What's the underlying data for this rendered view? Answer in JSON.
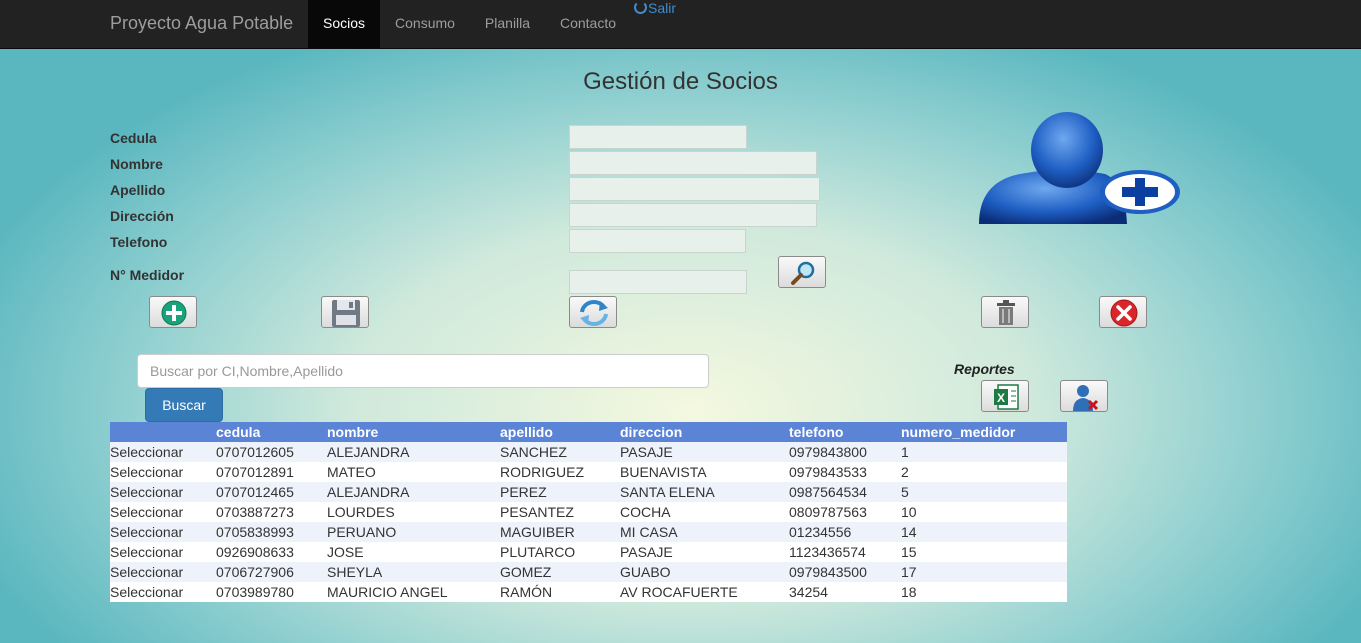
{
  "nav": {
    "brand": "Proyecto Agua Potable",
    "items": [
      {
        "label": "Socios",
        "active": true
      },
      {
        "label": "Consumo",
        "active": false
      },
      {
        "label": "Planilla",
        "active": false
      },
      {
        "label": "Contacto",
        "active": false
      }
    ],
    "logout": "Salir"
  },
  "page": {
    "title": "Gestión de Socios"
  },
  "form": {
    "cedula": {
      "label": "Cedula",
      "value": ""
    },
    "nombre": {
      "label": "Nombre",
      "value": ""
    },
    "apellido": {
      "label": "Apellido",
      "value": ""
    },
    "direccion": {
      "label": "Dirección",
      "value": ""
    },
    "telefono": {
      "label": "Telefono",
      "value": ""
    },
    "medidor": {
      "label": "N° Medidor",
      "value": ""
    }
  },
  "search": {
    "placeholder": "Buscar por CI,Nombre,Apellido",
    "value": "",
    "button": "Buscar"
  },
  "reports": {
    "label": "Reportes"
  },
  "colors": {
    "navbar": "#222222",
    "accent": "#337ab7",
    "table_header": "#5b84d6"
  },
  "icons": [
    "add-icon",
    "save-icon",
    "refresh-icon",
    "magnifier-icon",
    "trash-icon",
    "close-icon",
    "excel-icon",
    "user-remove-icon",
    "user-add-icon"
  ],
  "table": {
    "headers": [
      "",
      "cedula",
      "nombre",
      "apellido",
      "direccion",
      "telefono",
      "numero_medidor"
    ],
    "rows": [
      [
        "Seleccionar",
        "0707012605",
        "ALEJANDRA",
        "SANCHEZ",
        "PASAJE",
        "0979843800",
        "1"
      ],
      [
        "Seleccionar",
        "0707012891",
        "MATEO",
        "RODRIGUEZ",
        "BUENAVISTA",
        "0979843533",
        "2"
      ],
      [
        "Seleccionar",
        "0707012465",
        "ALEJANDRA",
        "PEREZ",
        "SANTA ELENA",
        "0987564534",
        "5"
      ],
      [
        "Seleccionar",
        "0703887273",
        "LOURDES",
        "PESANTEZ",
        "COCHA",
        "0809787563",
        "10"
      ],
      [
        "Seleccionar",
        "0705838993",
        "PERUANO",
        "MAGUIBER",
        "MI CASA",
        "01234556",
        "14"
      ],
      [
        "Seleccionar",
        "0926908633",
        "JOSE",
        "PLUTARCO",
        "PASAJE",
        "1123436574",
        "15"
      ],
      [
        "Seleccionar",
        "0706727906",
        "SHEYLA",
        "GOMEZ",
        "GUABO",
        "0979843500",
        "17"
      ],
      [
        "Seleccionar",
        "0703989780",
        "MAURICIO ANGEL",
        "RAMÓN",
        "AV ROCAFUERTE",
        "34254",
        "18"
      ]
    ]
  }
}
